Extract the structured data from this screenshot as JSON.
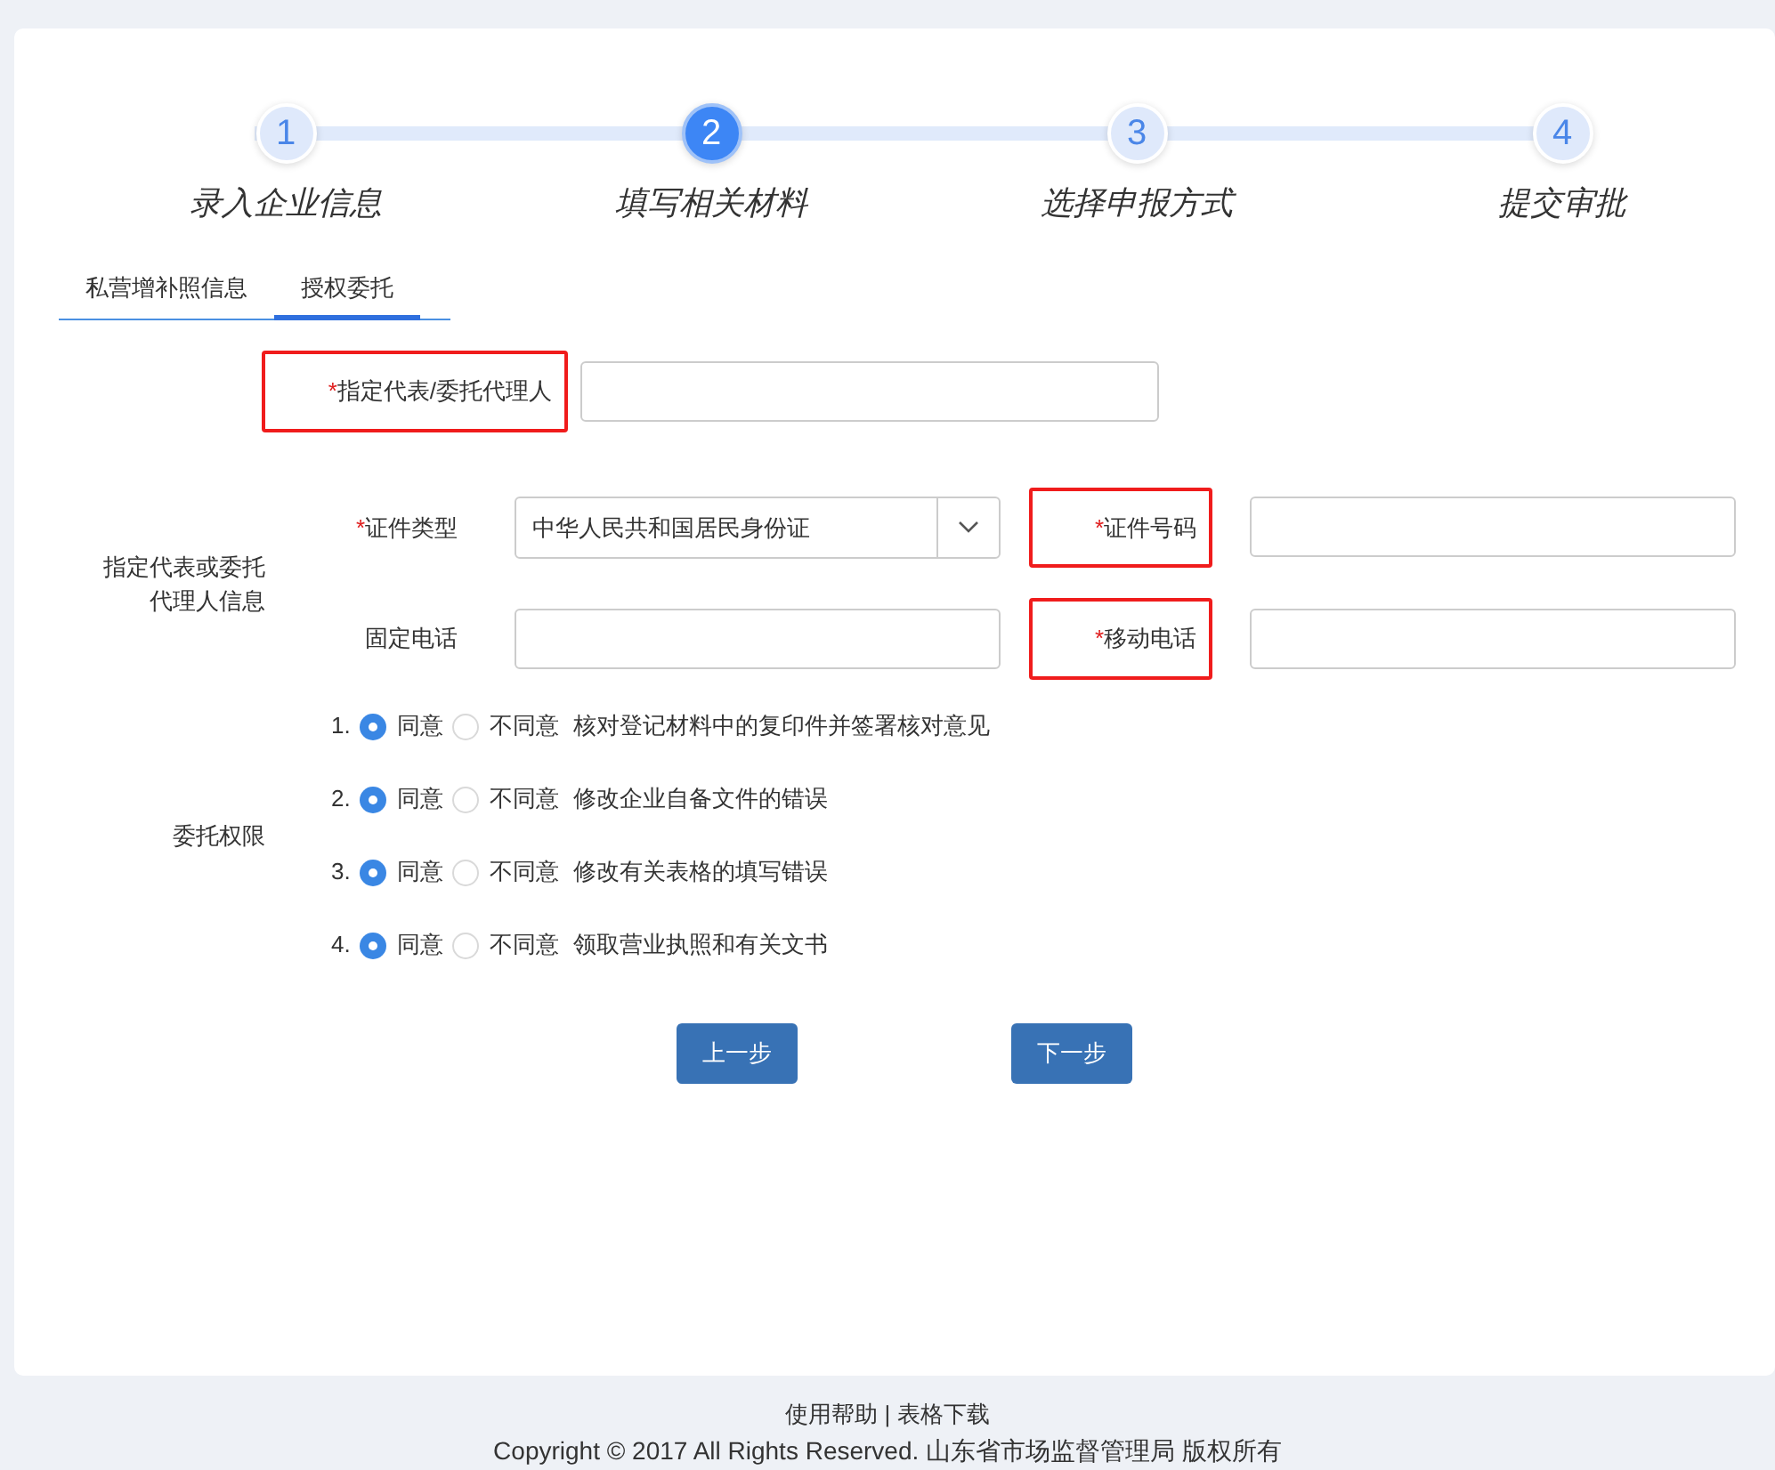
{
  "steps": [
    {
      "number": "1",
      "label": "录入企业信息",
      "selected": false
    },
    {
      "number": "2",
      "label": "填写相关材料",
      "selected": true
    },
    {
      "number": "3",
      "label": "选择申报方式",
      "selected": false
    },
    {
      "number": "4",
      "label": "提交审批",
      "selected": false
    }
  ],
  "tabs": [
    {
      "label": "私营增补照信息",
      "selected": false
    },
    {
      "label": "授权委托",
      "selected": true
    }
  ],
  "agent": {
    "label": "指定代表/委托代理人",
    "required_mark": "*",
    "highlighted": true
  },
  "id_section": {
    "label": "指定代表或委托代理人信息",
    "fields": [
      {
        "label": "证件类型",
        "required_mark": "*",
        "highlighted": false,
        "kind": "select",
        "value": "中华人民共和国居民身份证"
      },
      {
        "label": "证件号码",
        "required_mark": "*",
        "highlighted": true,
        "kind": "text"
      },
      {
        "label": "固定电话",
        "highlighted": false,
        "kind": "text"
      },
      {
        "label": "移动电话",
        "required_mark": "*",
        "highlighted": true,
        "kind": "text"
      }
    ]
  },
  "permissions": {
    "label": "委托权限",
    "items": [
      {
        "number": "1.",
        "choices": [
          {
            "label": "同意",
            "selected": true
          },
          {
            "label": "不同意",
            "selected": false
          }
        ],
        "text": "核对登记材料中的复印件并签署核对意见"
      },
      {
        "number": "2.",
        "choices": [
          {
            "label": "同意",
            "selected": true
          },
          {
            "label": "不同意",
            "selected": false
          }
        ],
        "text": "修改企业自备文件的错误"
      },
      {
        "number": "3.",
        "choices": [
          {
            "label": "同意",
            "selected": true
          },
          {
            "label": "不同意",
            "selected": false
          }
        ],
        "text": "修改有关表格的填写错误"
      },
      {
        "number": "4.",
        "choices": [
          {
            "label": "同意",
            "selected": true
          },
          {
            "label": "不同意",
            "selected": false
          }
        ],
        "text": "领取营业执照和有关文书"
      }
    ]
  },
  "buttons": [
    {
      "label": "上一步"
    },
    {
      "label": "下一步"
    }
  ],
  "footer": {
    "links": [
      "使用帮助",
      "表格下载"
    ],
    "separator": "|",
    "copyright": "Copyright © 2017 All Rights Reserved. 山东省市场监督管理局 版权所有"
  }
}
